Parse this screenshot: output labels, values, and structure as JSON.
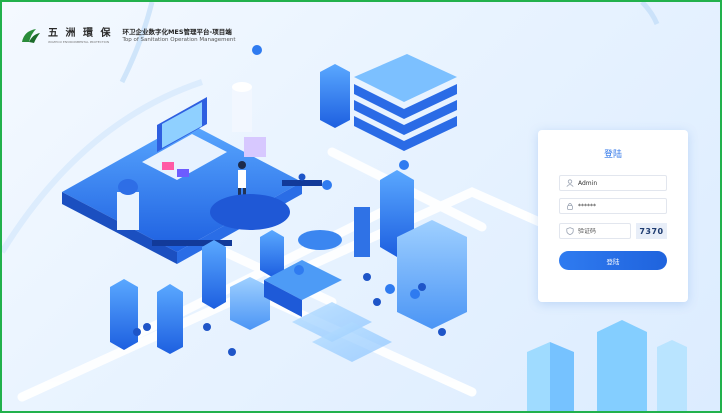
{
  "header": {
    "brand_name": "五 洲 環 保",
    "brand_tagline": "WUZHOU ENVIRONMENTAL PROTECTION",
    "title_cn": "环卫企业数字化MES管理平台-项目端",
    "title_en": "Top of Sanitation Operation Management"
  },
  "login": {
    "title": "登陆",
    "username_value": "Admin",
    "password_value": "******",
    "captcha_placeholder": "验证码",
    "captcha_code": "7370",
    "submit_label": "登陆"
  },
  "icons": {
    "logo": "wuzhou-leaf-logo-icon",
    "username": "user-icon",
    "password": "lock-icon",
    "captcha": "shield-icon"
  },
  "colors": {
    "accent": "#2f76e8",
    "frame_border": "#22b14c",
    "background": "#e8f3ff"
  }
}
